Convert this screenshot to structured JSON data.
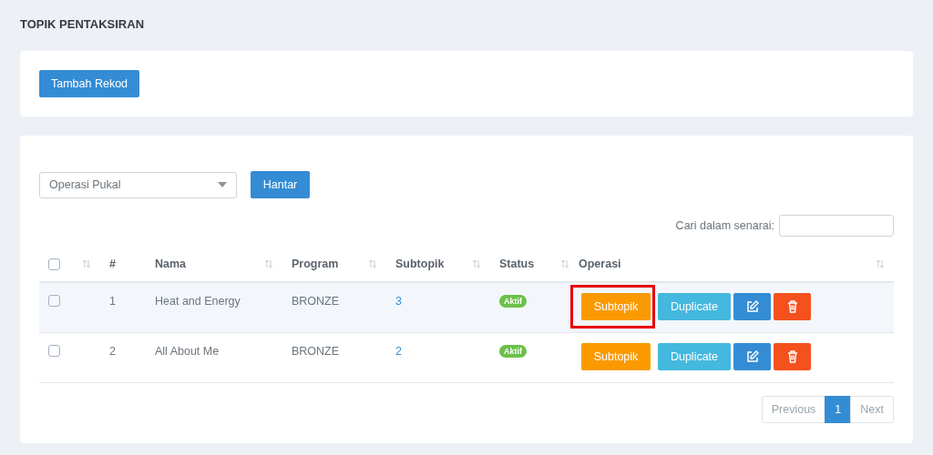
{
  "page_title": "TOPIK PENTAKSIRAN",
  "add_button": "Tambah Rekod",
  "bulk_select": {
    "value": "Operasi Pukal"
  },
  "submit_button": "Hantar",
  "search": {
    "label": "Cari dalam senarai:"
  },
  "table": {
    "select_all": {
      "checked": false
    },
    "columns": [
      "#",
      "Nama",
      "Program",
      "Subtopik",
      "Status",
      "Operasi"
    ],
    "rows": [
      {
        "checked": false,
        "number": "1",
        "name": "Heat and Energy",
        "program": "BRONZE",
        "subtopic_count": "3",
        "status": "Aktif",
        "hovered": true,
        "highlighted": true,
        "buttons": [
          "Subtopik",
          "Duplicate"
        ]
      },
      {
        "checked": false,
        "number": "2",
        "name": "All About Me",
        "program": "BRONZE",
        "subtopic_count": "2",
        "status": "Aktif",
        "hovered": false,
        "highlighted": false,
        "buttons": [
          "Subtopik",
          "Duplicate"
        ]
      }
    ]
  },
  "pagination": [
    {
      "label": "Previous",
      "selected": false
    },
    {
      "label": "1",
      "selected": true
    },
    {
      "label": "Next",
      "selected": false
    }
  ]
}
